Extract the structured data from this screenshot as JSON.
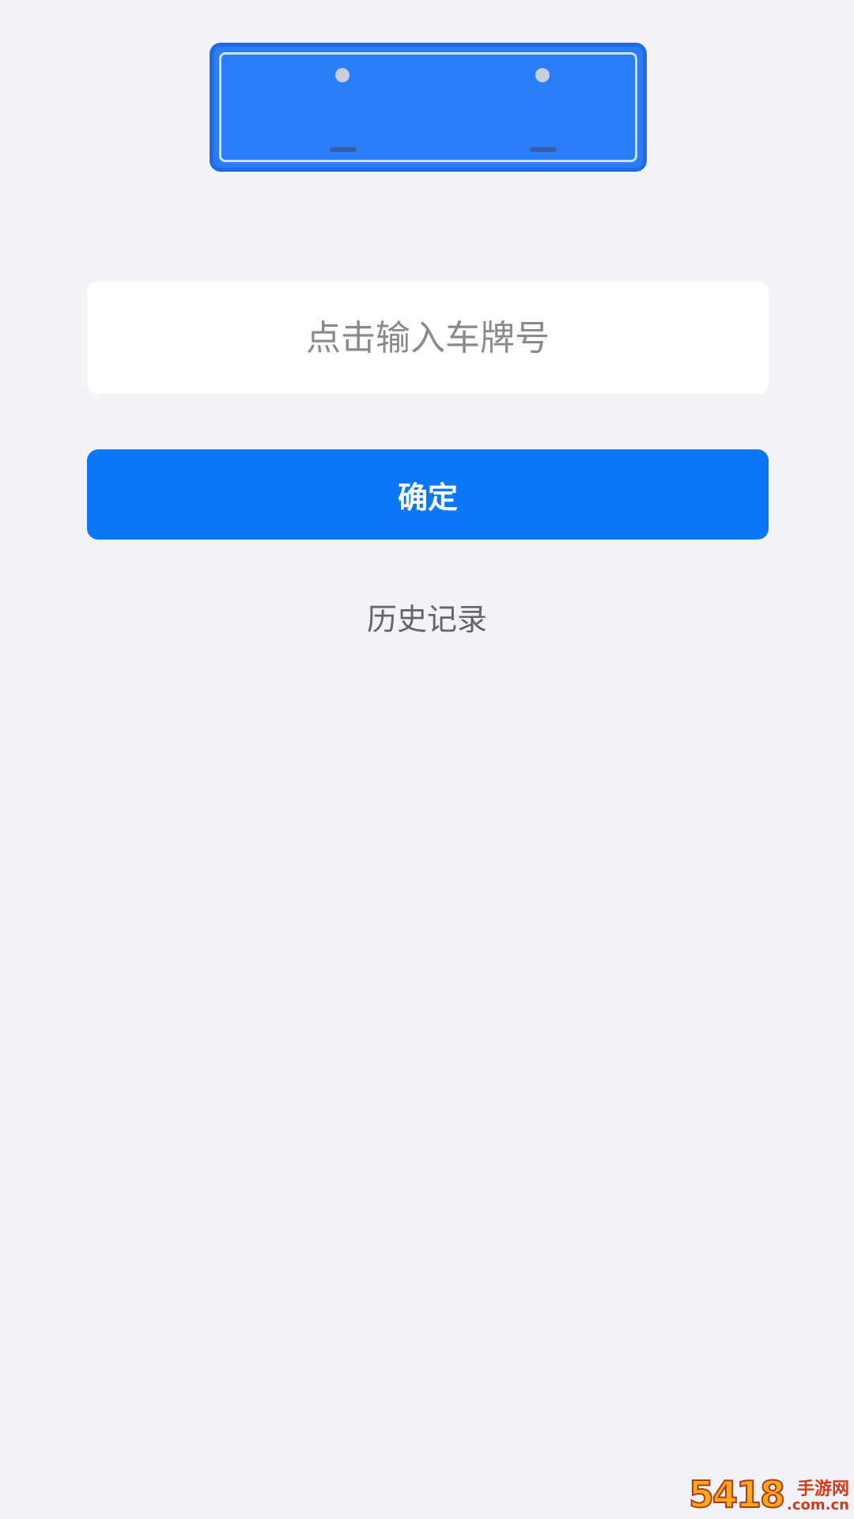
{
  "plate_illustration": {
    "icon": "license-plate-icon",
    "color": "#2a7cf7"
  },
  "plate_input": {
    "value": "",
    "placeholder": "点击输入车牌号"
  },
  "confirm_button": {
    "label": "确定",
    "color": "#0a78f6"
  },
  "history_link": {
    "label": "历史记录"
  },
  "watermark": {
    "logo_text": "5418",
    "site_name": "手游网",
    "domain": ".com.cn"
  }
}
